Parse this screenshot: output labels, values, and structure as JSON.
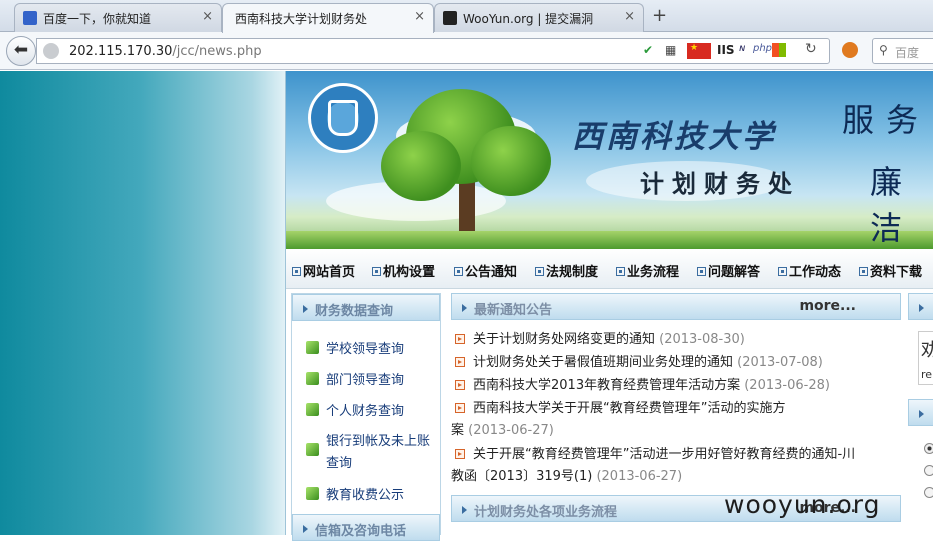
{
  "browser": {
    "tabs": [
      {
        "title": "百度一下，你就知道",
        "active": false
      },
      {
        "title": "西南科技大学计划财务处",
        "active": true
      },
      {
        "title": "WooYun.org | 提交漏洞",
        "active": false
      }
    ],
    "new_tab": "+",
    "close": "×",
    "url_host": "202.115.170.30",
    "url_path": "/jcc/news.php",
    "search_placeholder": "百度"
  },
  "site": {
    "banner": {
      "school_name": "西南科技大学",
      "dept_name": "计划财务处",
      "slogan1": "服务",
      "slogan2": "廉洁"
    },
    "menu": [
      "网站首页",
      "机构设置",
      "公告通知",
      "法规制度",
      "业务流程",
      "问题解答",
      "工作动态",
      "资料下载"
    ],
    "left": {
      "title": "财务数据查询",
      "links": [
        "学校领导查询",
        "部门领导查询",
        "个人财务查询",
        "银行到帐及未上账",
        "查询",
        "教育收费公示"
      ],
      "title2": "信箱及咨询电话"
    },
    "news": {
      "title": "最新通知公告",
      "more": "more...",
      "items": [
        {
          "text": "关于计划财务处网络变更的通知",
          "date": "(2013-08-30)"
        },
        {
          "text": "计划财务处关于暑假值班期间业务处理的通知",
          "date": "(2013-07-08)"
        },
        {
          "text": "西南科技大学2013年教育经费管理年活动方案",
          "date": "(2013-06-28)"
        },
        {
          "text": "西南科技大学关于开展“教育经费管理年”活动的实施方",
          "text2": "案",
          "date": "(2013-06-27)"
        },
        {
          "text": "关于开展“教育经费管理年”活动进一步用好管好教育经费的通知-川",
          "text2": "教函〔2013〕319号(1)",
          "date": "(2013-06-27)"
        }
      ],
      "title2": "计划财务处各项业务流程",
      "more2": "more..."
    },
    "right": {
      "glyph1": "劝",
      "glyph2": "re"
    }
  },
  "watermark": "wooyun.org"
}
